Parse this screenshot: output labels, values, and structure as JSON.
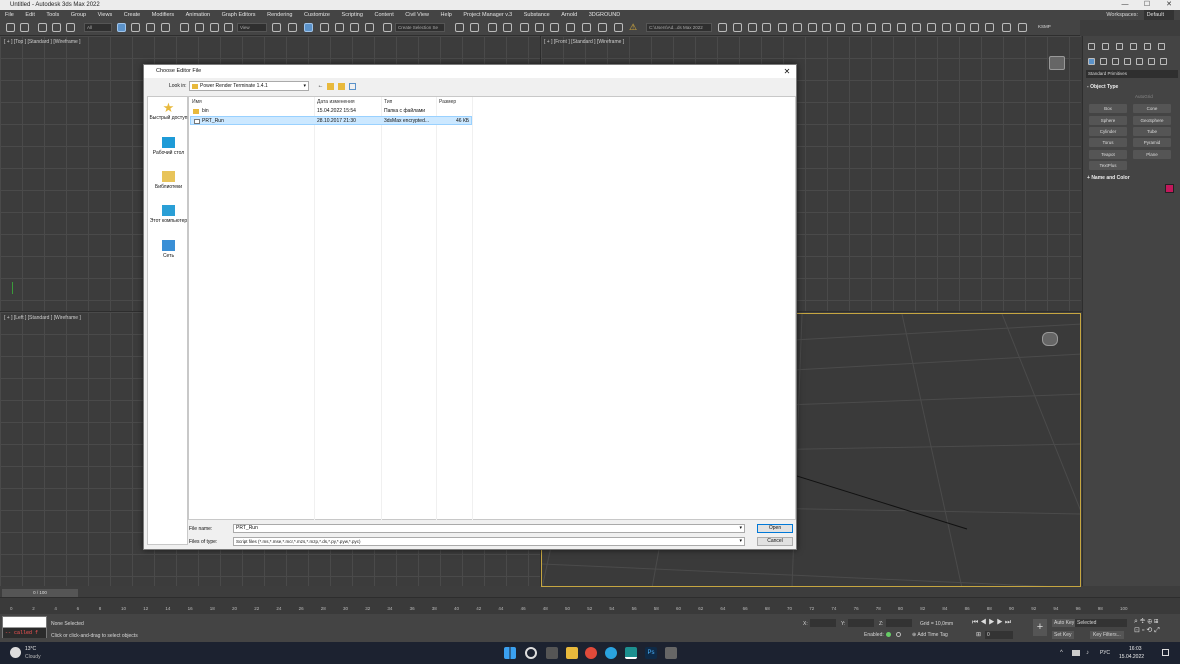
{
  "window": {
    "title": "Untitled - Autodesk 3ds Max 2022",
    "controls": [
      "—",
      "☐",
      "✕"
    ]
  },
  "menu": [
    "File",
    "Edit",
    "Tools",
    "Group",
    "Views",
    "Create",
    "Modifiers",
    "Animation",
    "Graph Editors",
    "Rendering",
    "Customize",
    "Scripting",
    "Content",
    "Civil View",
    "Help",
    "Project Manager v.3",
    "Substance",
    "Arnold",
    "3DGROUND"
  ],
  "workspaces": {
    "label": "Workspaces:",
    "value": "Default"
  },
  "toolbar": {
    "filter": "All",
    "view": "View",
    "selection_set": "Create Selection Se",
    "path": "C:\\Users\\Ad...ds Max 2022",
    "ksmp": "KSMP"
  },
  "viewports": {
    "top": "[ + ] [Top ] [Standard ] [Wireframe ]",
    "front": "[ + ] [Front ] [Standard ] [Wireframe ]",
    "left": "[ + ] [Left ] [Standard ] [Wireframe ]"
  },
  "command_panel": {
    "category": "Standard Primitives",
    "object_type": "Object Type",
    "autogrid": "AutoGrid",
    "buttons": [
      "Box",
      "Cone",
      "Sphere",
      "GeoSphere",
      "Cylinder",
      "Tube",
      "Torus",
      "Pyramid",
      "Teapot",
      "Plane",
      "TextPlus"
    ],
    "name_and_color": "Name and Color",
    "color": "#c2185b"
  },
  "dialog": {
    "title": "Choose Editor File",
    "look_in_label": "Look in:",
    "look_in_value": "Power Render Terminate 1.4.1",
    "places": [
      "Быстрый доступ",
      "Рабочий стол",
      "Библиотеки",
      "Этот компьютер",
      "Сеть"
    ],
    "columns": [
      "Имя",
      "Дата изменения",
      "Тип",
      "Размер"
    ],
    "files": [
      {
        "name": "bin",
        "date": "15.04.2022 15:54",
        "type": "Папка с файлами",
        "size": "",
        "icon": "folder-icon"
      },
      {
        "name": "PRT_Run",
        "date": "28.10.2017 21:30",
        "type": "3dsMax encrypted...",
        "size": "46 КБ",
        "icon": "file-icon"
      }
    ],
    "file_name_label": "File name:",
    "file_name_value": "PRT_Run",
    "file_type_label": "Files of type:",
    "file_type_value": "Script files (*.ms,*.mse,*.mcr,*.mzs,*.mzp,*.ds,*.py,*.pyw,*.pyc)",
    "open_label": "Open",
    "cancel_label": "Cancel"
  },
  "timeline": {
    "frame_display": "0 / 100",
    "ticks": [
      "0",
      "2",
      "4",
      "6",
      "8",
      "10",
      "12",
      "14",
      "16",
      "18",
      "20",
      "22",
      "24",
      "26",
      "28",
      "30",
      "32",
      "34",
      "36",
      "38",
      "40",
      "42",
      "44",
      "46",
      "48",
      "50",
      "52",
      "54",
      "56",
      "58",
      "60",
      "62",
      "64",
      "66",
      "68",
      "70",
      "72",
      "74",
      "76",
      "78",
      "80",
      "82",
      "84",
      "86",
      "88",
      "90",
      "92",
      "94",
      "96",
      "98",
      "100"
    ]
  },
  "status": {
    "script_listener": "called f",
    "selection": "None Selected",
    "prompt": "Click or click-and-drag to select objects",
    "x_label": "X:",
    "y_label": "Y:",
    "z_label": "Z:",
    "grid": "Grid = 10,0mm",
    "enabled": "Enabled:",
    "add_time_tag": "Add Time Tag",
    "auto_key": "Auto Key",
    "set_key": "Set Key",
    "selected": "Selected",
    "key_filters": "Key Filters...",
    "frame": "0"
  },
  "taskbar": {
    "weather_temp": "13°C",
    "weather_text": "Cloudy",
    "lang": "РУС",
    "time": "16:03",
    "date": "15.04.2022"
  }
}
